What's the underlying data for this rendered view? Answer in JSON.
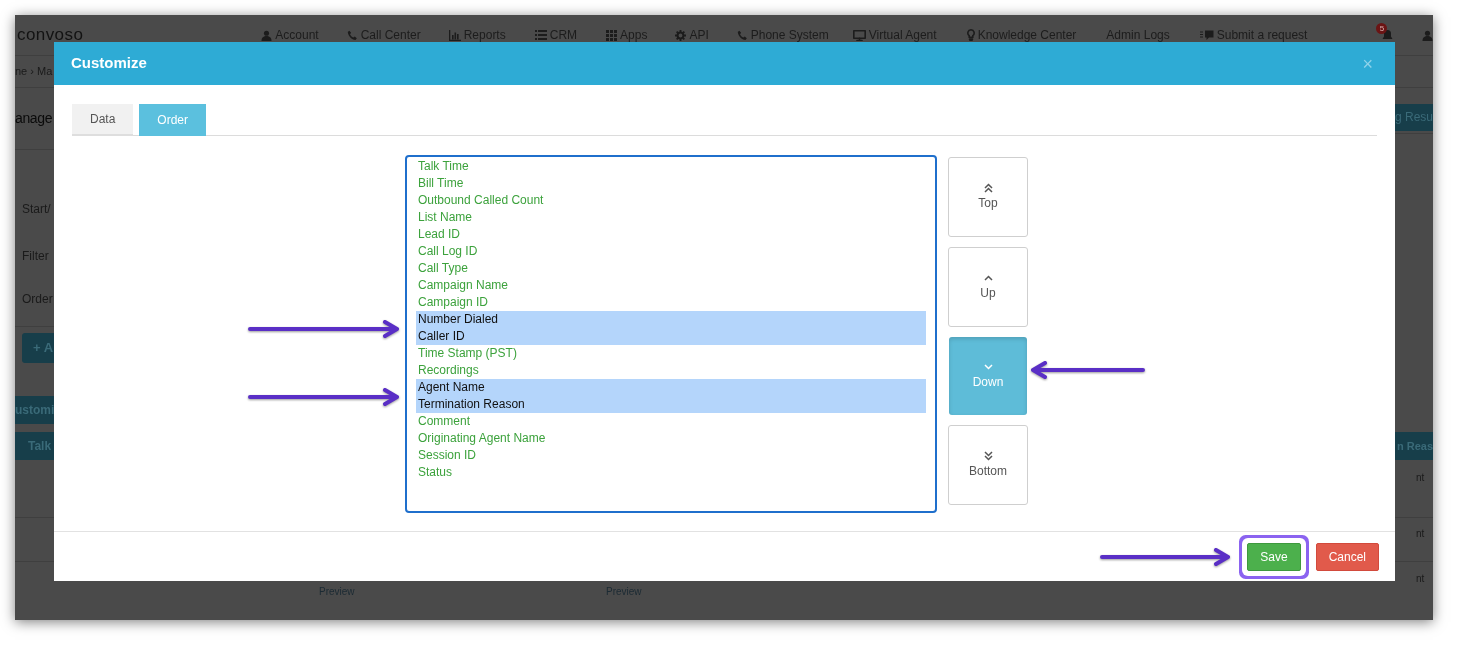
{
  "nav": {
    "logo": "convoso",
    "items": [
      {
        "label": "Account",
        "kind": "user"
      },
      {
        "label": "Call Center",
        "kind": "phone"
      },
      {
        "label": "Reports",
        "kind": "chart"
      },
      {
        "label": "CRM",
        "kind": "list"
      },
      {
        "label": "Apps",
        "kind": "grid"
      },
      {
        "label": "API",
        "kind": "gear"
      },
      {
        "label": "Phone System",
        "kind": "phone"
      },
      {
        "label": "Virtual Agent",
        "kind": "monitor"
      },
      {
        "label": "Knowledge Center",
        "kind": "bulb"
      },
      {
        "label": "Admin Logs",
        "kind": "plain"
      },
      {
        "label": "Submit a request",
        "kind": "chat"
      }
    ],
    "notification_count": "5"
  },
  "background": {
    "breadcrumb": "ne › Ma",
    "heading": "anage",
    "filters": [
      "Start/",
      "Filter",
      "Order"
    ],
    "add_button": "+ A",
    "customize_button": "ustomi",
    "table_header_left": "Talk",
    "right_button": "g Resu",
    "table_header_right": "n Reas",
    "right_cells": [
      "nt",
      "nt",
      "nt"
    ],
    "preview_links": [
      "Preview",
      "Preview"
    ]
  },
  "modal": {
    "title": "Customize",
    "close": "×",
    "tabs": [
      {
        "label": "Data",
        "selected": false
      },
      {
        "label": "Order",
        "selected": true
      }
    ],
    "list": [
      {
        "label": "Talk Time",
        "selected": false
      },
      {
        "label": "Bill Time",
        "selected": false
      },
      {
        "label": "Outbound Called Count",
        "selected": false
      },
      {
        "label": "List Name",
        "selected": false
      },
      {
        "label": "Lead ID",
        "selected": false
      },
      {
        "label": "Call Log ID",
        "selected": false
      },
      {
        "label": "Call Type",
        "selected": false
      },
      {
        "label": "Campaign Name",
        "selected": false
      },
      {
        "label": "Campaign ID",
        "selected": false
      },
      {
        "label": "Number Dialed",
        "selected": true,
        "arrow": true
      },
      {
        "label": "Caller ID",
        "selected": true
      },
      {
        "label": "Time Stamp (PST)",
        "selected": false
      },
      {
        "label": "Recordings",
        "selected": false
      },
      {
        "label": "Agent Name",
        "selected": true,
        "arrow": true
      },
      {
        "label": "Termination Reason",
        "selected": true
      },
      {
        "label": "Comment",
        "selected": false
      },
      {
        "label": "Originating Agent Name",
        "selected": false
      },
      {
        "label": "Session ID",
        "selected": false
      },
      {
        "label": "Status",
        "selected": false
      }
    ],
    "move_buttons": [
      {
        "label": "Top",
        "kind": "top",
        "active": false
      },
      {
        "label": "Up",
        "kind": "up",
        "active": false
      },
      {
        "label": "Down",
        "kind": "down",
        "active": true,
        "arrow": true
      },
      {
        "label": "Bottom",
        "kind": "bottom",
        "active": false
      }
    ],
    "footer_buttons": [
      {
        "label": "Save",
        "kind": "save",
        "highlighted": true,
        "arrow": true
      },
      {
        "label": "Cancel",
        "kind": "cancel"
      }
    ]
  }
}
